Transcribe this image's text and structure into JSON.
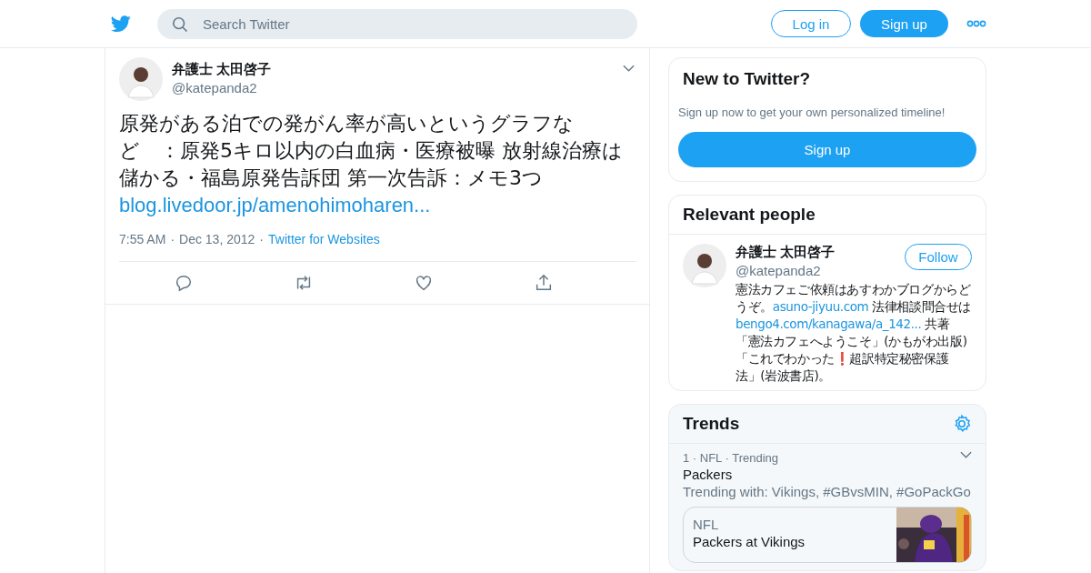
{
  "header": {
    "search": {
      "placeholder": "Search Twitter"
    },
    "login": "Log in",
    "signup": "Sign up"
  },
  "tweet": {
    "name": "弁護士 太田啓子",
    "handle": "@katepanda2",
    "text": "原発がある泊での発がん率が高いというグラフなど　：原発5キロ以内の白血病・医療被曝 放射線治療は儲かる・福島原発告訴団 第一次告訴：メモ3つ",
    "link": "blog.livedoor.jp/amenohimoharen...",
    "time": "7:55 AM",
    "separator": "·",
    "date": "Dec 13, 2012",
    "source": "Twitter for Websites"
  },
  "new_to_twitter": {
    "title": "New to Twitter?",
    "subtitle": "Sign up now to get your own personalized timeline!",
    "button": "Sign up"
  },
  "relevant_people": {
    "title": "Relevant people",
    "people": [
      {
        "name": "弁護士 太田啓子",
        "handle": "@katepanda2",
        "button": "Follow",
        "bio": [
          {
            "kind": "text",
            "text": "憲法カフェご依頼はあすわかブログからどうぞ。"
          },
          {
            "kind": "link",
            "text": "asuno-jiyuu.com"
          },
          {
            "kind": "text",
            "text": " 法律相談問合せは"
          },
          {
            "kind": "link",
            "text": "bengo4.com/kanagawa/a_142..."
          },
          {
            "kind": "text",
            "text": " 共著「憲法カフェへようこそ」(かもがわ出版)「これでわかった❗超訳特定秘密保護法」(岩波書店)。"
          }
        ]
      }
    ]
  },
  "trends": {
    "title": "Trends",
    "items": [
      {
        "meta": "1 · NFL · Trending",
        "name": "Packers",
        "context": "Trending with: Vikings, #GBvsMIN, #GoPackGo",
        "card": {
          "category": "NFL",
          "headline": "Packers at Vikings"
        }
      }
    ]
  }
}
